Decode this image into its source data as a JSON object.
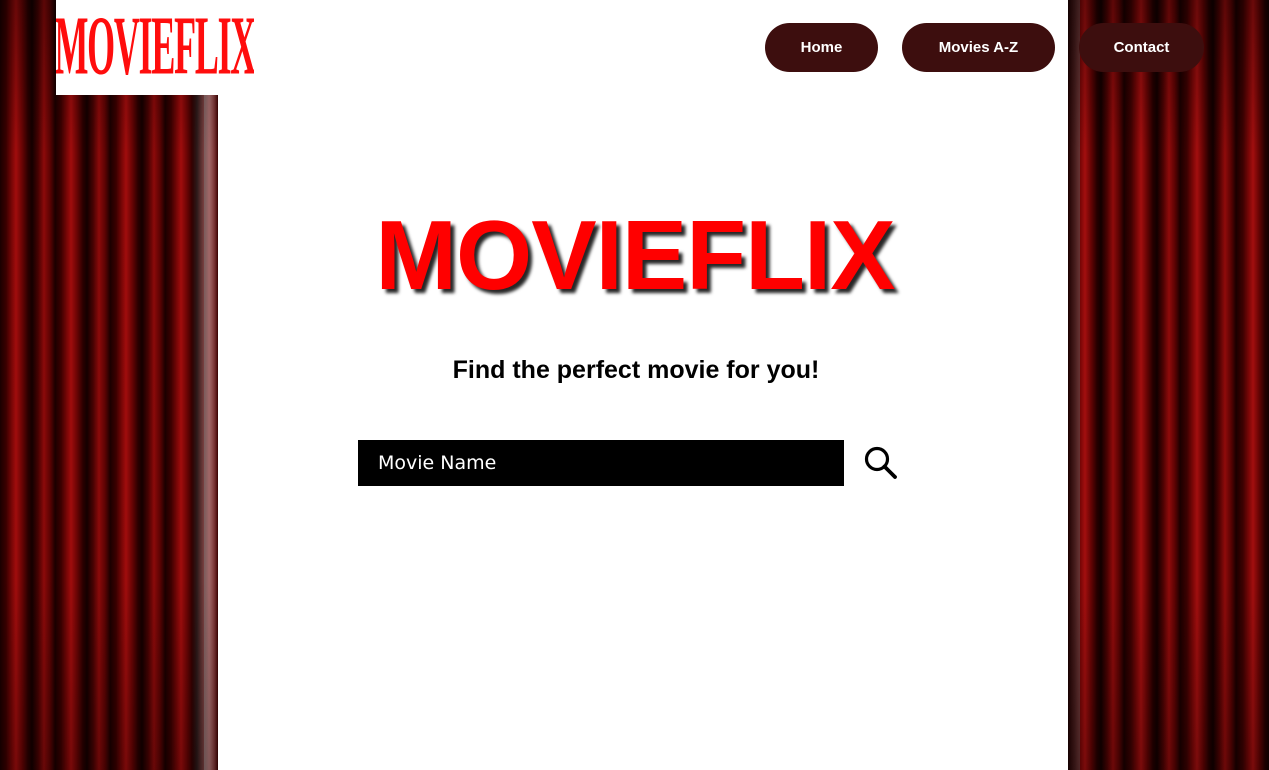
{
  "brand": {
    "logo_text": "MOVIEFLIX",
    "logo_color": "#ff0d0d"
  },
  "nav": {
    "items": [
      {
        "label": "Home"
      },
      {
        "label": "Movies A-Z"
      },
      {
        "label": "Contact"
      }
    ],
    "button_color": "#3d0e0e"
  },
  "hero": {
    "title": "MOVIEFLIX",
    "title_color": "#ff0000",
    "tagline": "Find the perfect movie for you!"
  },
  "search": {
    "placeholder": "Movie Name",
    "value": "",
    "icon": "search-icon"
  },
  "decor": {
    "curtain_color": "#8c0a0a"
  }
}
